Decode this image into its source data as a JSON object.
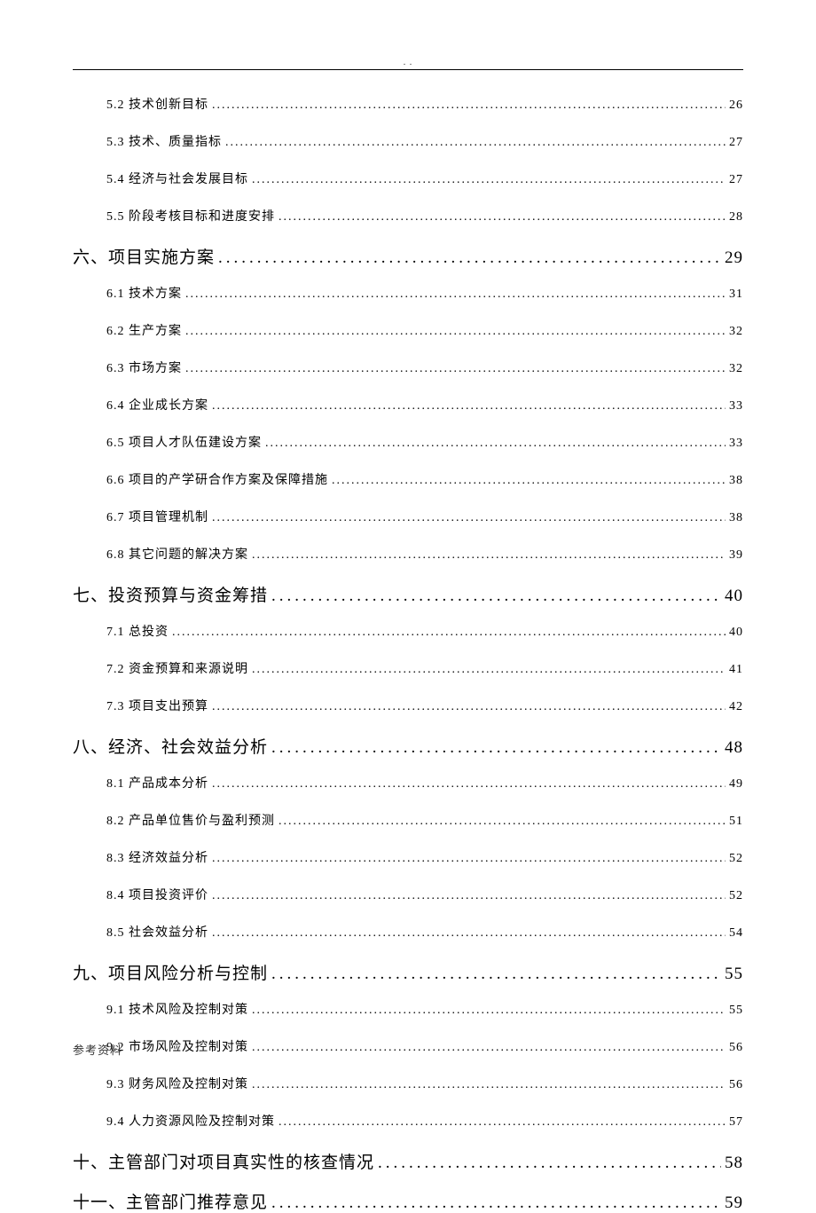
{
  "header_marks": ". .",
  "footer": "参考资料",
  "toc": [
    {
      "level": "sub",
      "title": "5.2 技术创新目标",
      "page": "26"
    },
    {
      "level": "sub",
      "title": "5.3 技术、质量指标",
      "page": "27"
    },
    {
      "level": "sub",
      "title": "5.4 经济与社会发展目标",
      "page": "27"
    },
    {
      "level": "sub",
      "title": "5.5 阶段考核目标和进度安排",
      "page": "28"
    },
    {
      "level": "main",
      "title": "六、项目实施方案",
      "page": "29"
    },
    {
      "level": "sub",
      "title": "6.1 技术方案",
      "page": "31"
    },
    {
      "level": "sub",
      "title": "6.2 生产方案",
      "page": "32"
    },
    {
      "level": "sub",
      "title": "6.3 市场方案",
      "page": "32"
    },
    {
      "level": "sub",
      "title": "6.4 企业成长方案",
      "page": "33"
    },
    {
      "level": "sub",
      "title": "6.5 项目人才队伍建设方案",
      "page": "33"
    },
    {
      "level": "sub",
      "title": "6.6 项目的产学研合作方案及保障措施",
      "page": "38"
    },
    {
      "level": "sub",
      "title": "6.7 项目管理机制",
      "page": "38"
    },
    {
      "level": "sub",
      "title": "6.8 其它问题的解决方案",
      "page": "39"
    },
    {
      "level": "main",
      "title": "七、投资预算与资金筹措",
      "page": "40"
    },
    {
      "level": "sub",
      "title": "7.1 总投资",
      "page": "40"
    },
    {
      "level": "sub",
      "title": "7.2 资金预算和来源说明",
      "page": "41"
    },
    {
      "level": "sub",
      "title": "7.3 项目支出预算",
      "page": "42"
    },
    {
      "level": "main",
      "title": "八、经济、社会效益分析",
      "page": "48"
    },
    {
      "level": "sub",
      "title": "8.1 产品成本分析",
      "page": "49"
    },
    {
      "level": "sub",
      "title": "8.2 产品单位售价与盈利预测",
      "page": "51"
    },
    {
      "level": "sub",
      "title": "8.3 经济效益分析",
      "page": "52"
    },
    {
      "level": "sub",
      "title": "8.4 项目投资评价",
      "page": "52"
    },
    {
      "level": "sub",
      "title": "8.5 社会效益分析",
      "page": "54"
    },
    {
      "level": "main",
      "title": "九、项目风险分析与控制",
      "page": "55"
    },
    {
      "level": "sub",
      "title": "9.1 技术风险及控制对策",
      "page": "55"
    },
    {
      "level": "sub",
      "title": "9.2 市场风险及控制对策",
      "page": "56"
    },
    {
      "level": "sub",
      "title": "9.3 财务风险及控制对策",
      "page": "56"
    },
    {
      "level": "sub",
      "title": "9.4 人力资源风险及控制对策",
      "page": "57"
    },
    {
      "level": "main",
      "title": "十、主管部门对项目真实性的核查情况",
      "page": "58"
    },
    {
      "level": "main",
      "title": "十一、主管部门推荐意见",
      "page": "59"
    }
  ]
}
